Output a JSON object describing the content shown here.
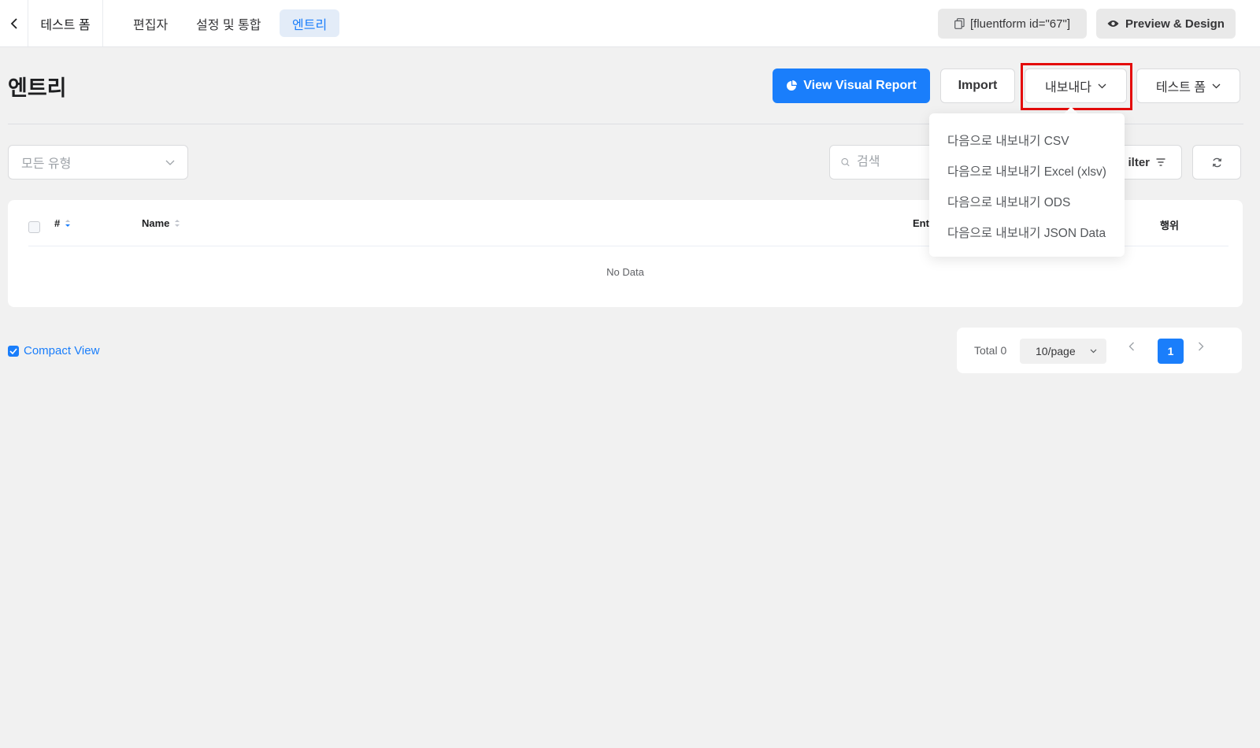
{
  "topbar": {
    "form_name": "테스트 폼",
    "tabs": [
      {
        "label": "편집자"
      },
      {
        "label": "설정 및 통합"
      },
      {
        "label": "엔트리"
      }
    ],
    "shortcode": "[fluentform id=\"67\"]",
    "preview_label": "Preview & Design"
  },
  "header": {
    "title": "엔트리",
    "visual_report_label": "View Visual Report",
    "import_label": "Import",
    "export_label": "내보내다",
    "form_select_label": "테스트 폼"
  },
  "filters": {
    "type_select": "모든 유형",
    "search_placeholder": "검색",
    "filter_label": "ilter"
  },
  "table": {
    "columns": [
      "#",
      "Name",
      "Ent",
      "행위"
    ],
    "empty_text": "No Data"
  },
  "compact_view_label": "Compact View",
  "pagination": {
    "total": "Total 0",
    "page_size": "10/page",
    "current_page": "1"
  },
  "export_menu": {
    "items": [
      {
        "label": "다음으로 내보내기 CSV"
      },
      {
        "label": "다음으로 내보내기 Excel (xlsv)"
      },
      {
        "label": "다음으로 내보내기 ODS"
      },
      {
        "label": "다음으로 내보내기 JSON Data"
      }
    ]
  },
  "colors": {
    "primary": "#1a7efb",
    "highlight_outline": "#e40b0b",
    "background": "#f1f1f1"
  }
}
